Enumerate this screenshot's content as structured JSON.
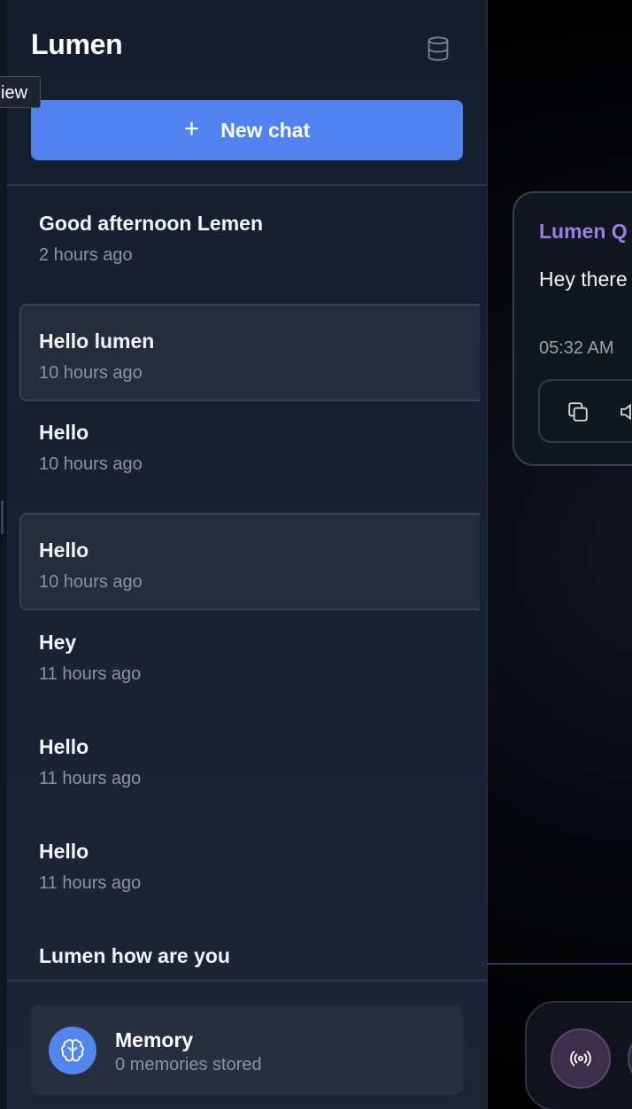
{
  "app": {
    "title": "Lumen"
  },
  "tooltip": {
    "text": "iew"
  },
  "sidebar": {
    "new_chat_label": "New chat",
    "new_chat_icon": "plus-icon",
    "database_icon": "database-icon",
    "chats": [
      {
        "title": "Good afternoon Lemen",
        "time": "2 hours ago",
        "boxed": false
      },
      {
        "title": "Hello lumen",
        "time": "10 hours ago",
        "boxed": true
      },
      {
        "title": "Hello",
        "time": "10 hours ago",
        "boxed": false
      },
      {
        "title": "Hello",
        "time": "10 hours ago",
        "boxed": true
      },
      {
        "title": "Hey",
        "time": "11 hours ago",
        "boxed": false
      },
      {
        "title": "Hello",
        "time": "11 hours ago",
        "boxed": false
      },
      {
        "title": "Hello",
        "time": "11 hours ago",
        "boxed": false
      },
      {
        "title": "Lumen how are you",
        "time": "",
        "boxed": false
      }
    ],
    "memory": {
      "title": "Memory",
      "subtitle": "0 memories stored",
      "icon": "brain-icon"
    }
  },
  "main": {
    "message": {
      "sender": "Lumen Q",
      "text": "Hey there mind toda",
      "time": "05:32 AM",
      "actions": [
        "copy-icon",
        "speaker-icon"
      ]
    },
    "input_bar": {
      "voice_icon": "broadcast-icon"
    }
  },
  "colors": {
    "accent": "#5083ef",
    "sender": "#9b7fe6",
    "sidebar_bg": "#1a2133",
    "muted_text": "#8c94a3"
  }
}
